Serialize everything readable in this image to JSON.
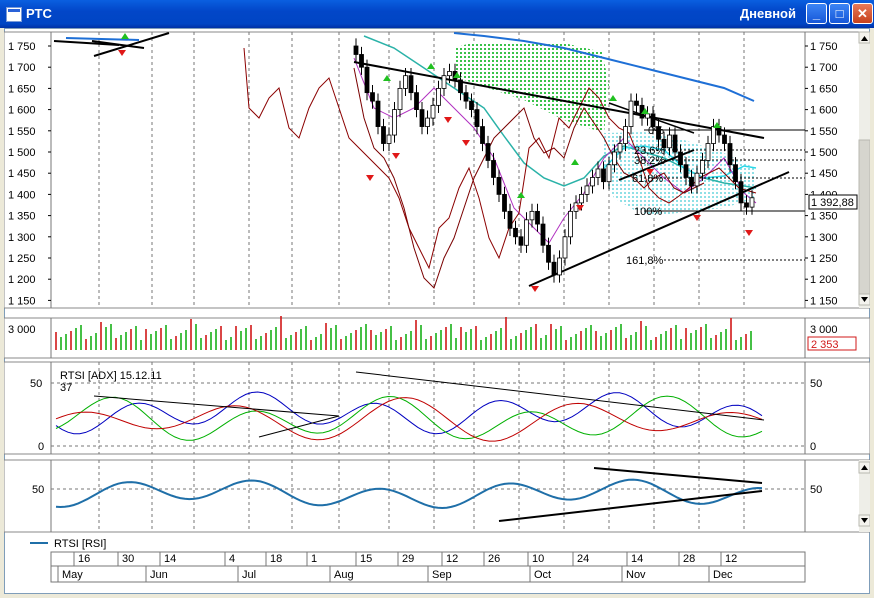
{
  "window": {
    "title": "РТС",
    "period": "Дневной",
    "min_label": "_",
    "max_label": "□",
    "close_label": "✕"
  },
  "price_panel": {
    "y_ticks": [
      "1 750",
      "1 700",
      "1 650",
      "1 600",
      "1 550",
      "1 500",
      "1 450",
      "1 400",
      "1 350",
      "1 300",
      "1 250",
      "1 200",
      "1 150"
    ],
    "last_value": "1 392,88",
    "fib_labels": [
      "0%",
      "23,6%",
      "38,2%",
      "61,8%",
      "100%",
      "161,8%"
    ]
  },
  "volume_panel": {
    "top_tick": "3 000",
    "last_value": "2 353"
  },
  "adx_panel": {
    "label": "RTSI [ADX] 15.12.11",
    "value": "37",
    "ticks": [
      "50",
      "0"
    ]
  },
  "rsi_panel": {
    "ticks": [
      "50"
    ]
  },
  "legend": {
    "label": "RTSI [RSI]"
  },
  "axis": {
    "days": [
      "16",
      "30",
      "14",
      "4",
      "18",
      "1",
      "15",
      "29",
      "12",
      "26",
      "10",
      "24",
      "14",
      "28",
      "12"
    ],
    "months": [
      "May",
      "Jun",
      "Jul",
      "Aug",
      "Sep",
      "Oct",
      "Nov",
      "Dec"
    ]
  },
  "colors": {
    "candle_up": "#000000",
    "ma_slow": "#1e6fd6",
    "adx": "#0000c0",
    "plus_di": "#00b000",
    "minus_di": "#c00000",
    "rsi": "#1f6fa8",
    "volume_up": "#18b018",
    "volume_down": "#d01818",
    "signal_up": "#20c020",
    "signal_down": "#e01818"
  }
}
